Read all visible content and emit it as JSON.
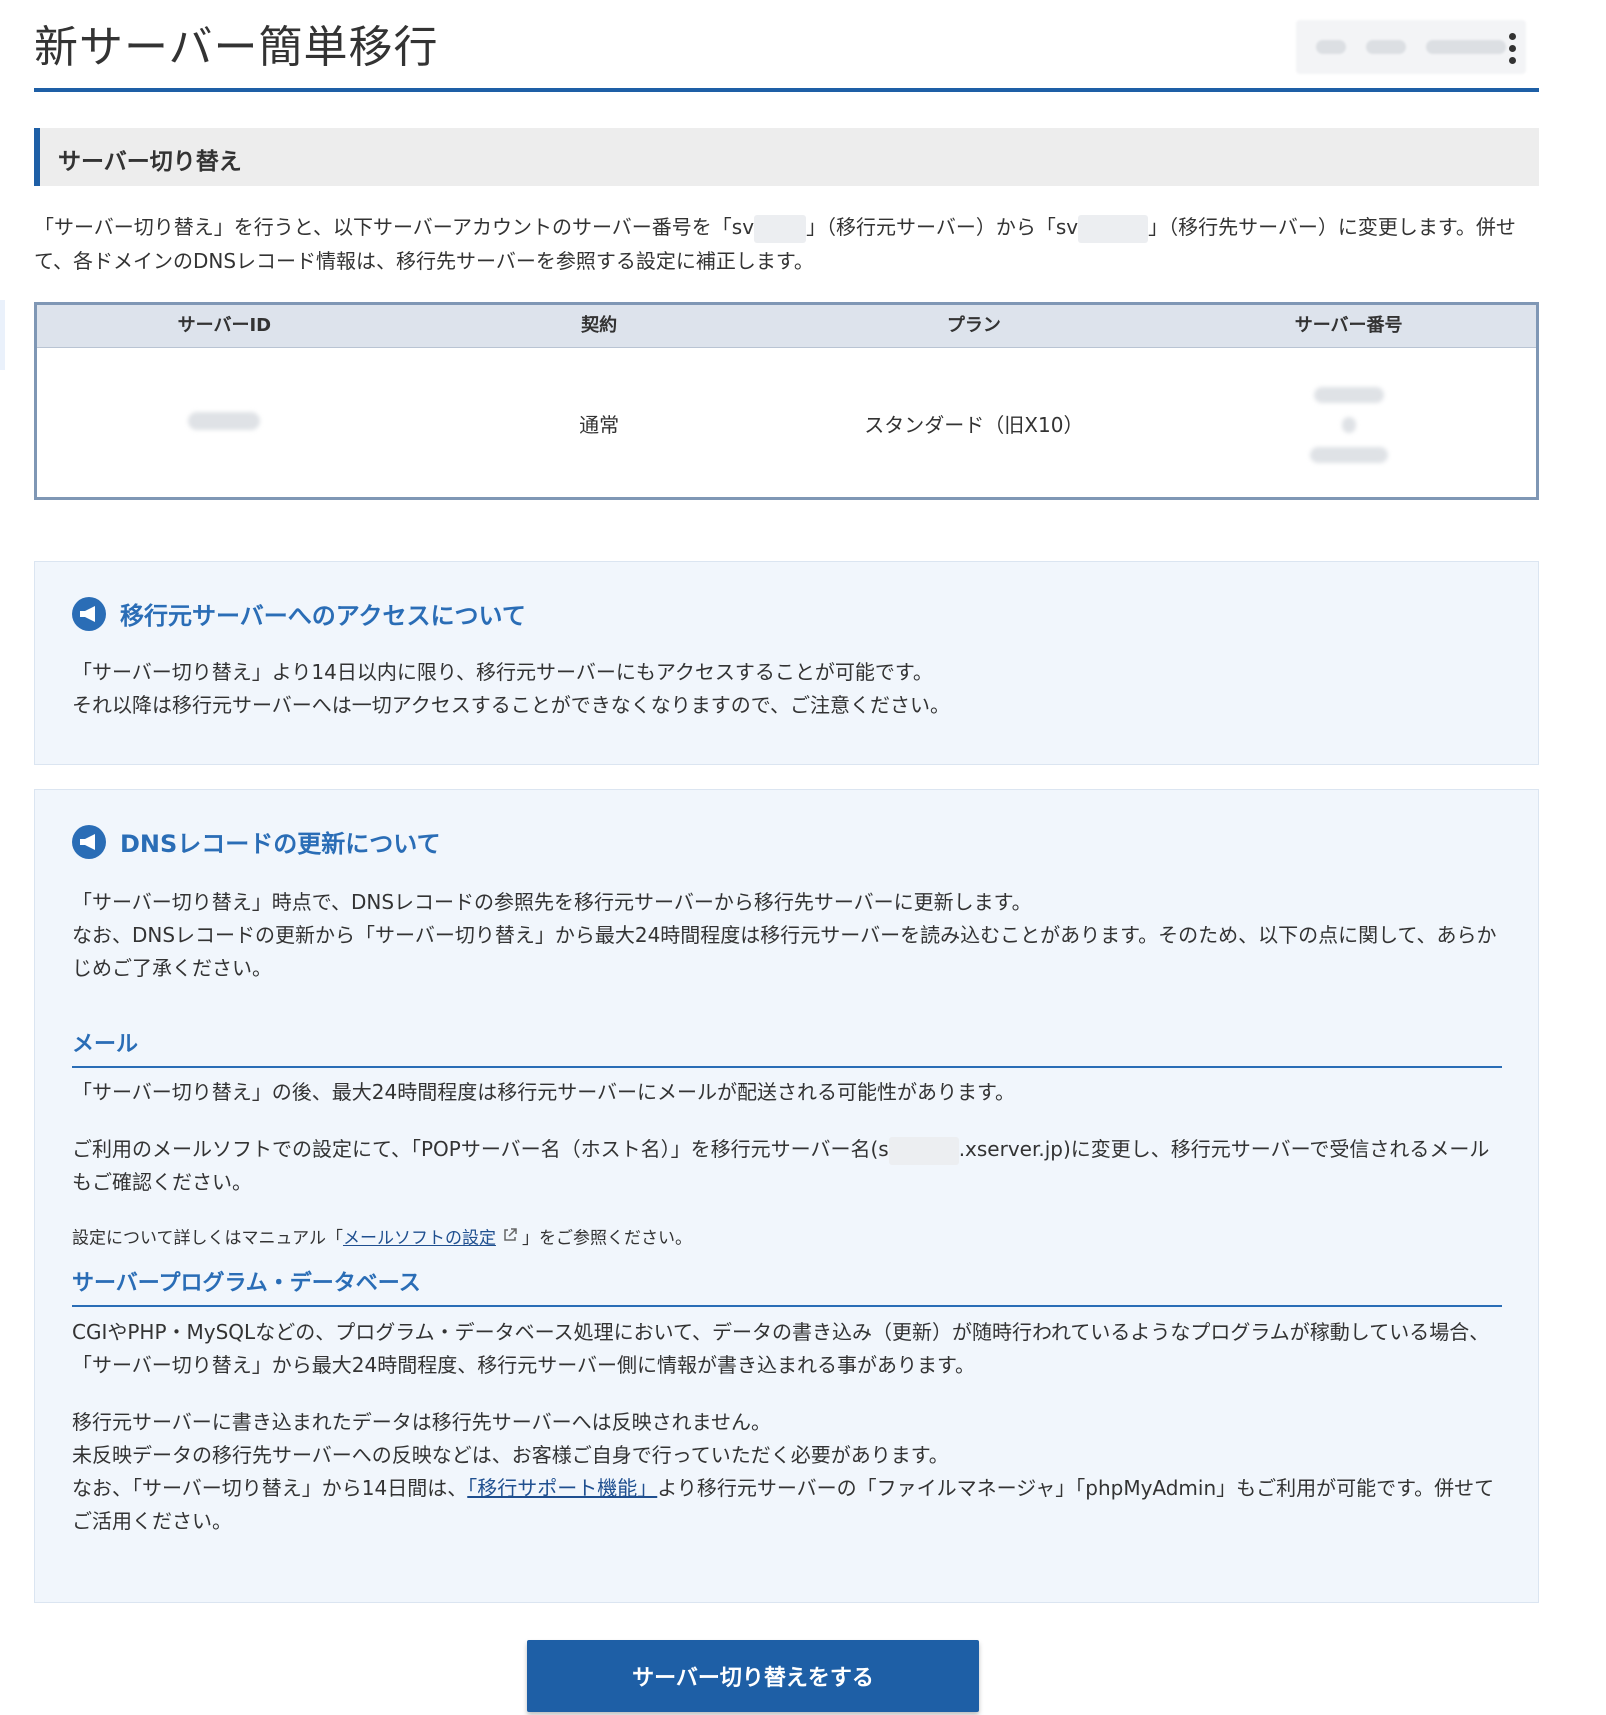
{
  "header": {
    "title": "新サーバー簡単移行"
  },
  "section": {
    "title": "サーバー切り替え"
  },
  "intro": {
    "p1": "「サーバー切り替え」を行うと、以下サーバーアカウントのサーバー番号を「sv",
    "p2": "」（移行元サーバー）から「sv",
    "p3": "」（移行先サーバー）に変更します。併せて、各ドメインのDNSレコード情報は、移行先サーバーを参照する設定に補正します。"
  },
  "table": {
    "headers": [
      "サーバーID",
      "契約",
      "プラン",
      "サーバー番号"
    ],
    "row": {
      "contract": "通常",
      "plan": "スタンダード（旧X10）"
    }
  },
  "notice1": {
    "title": "移行元サーバーへのアクセスについて",
    "line1": "「サーバー切り替え」より14日以内に限り、移行元サーバーにもアクセスすることが可能です。",
    "line2": "それ以降は移行元サーバーへは一切アクセスすることができなくなりますので、ご注意ください。"
  },
  "notice2": {
    "title": "DNSレコードの更新について",
    "intro1": "「サーバー切り替え」時点で、DNSレコードの参照先を移行元サーバーから移行先サーバーに更新します。",
    "intro2": "なお、DNSレコードの更新から「サーバー切り替え」から最大24時間程度は移行元サーバーを読み込むことがあります。そのため、以下の点に関して、あらかじめご了承ください。",
    "mail": {
      "heading": "メール",
      "p1": "「サーバー切り替え」の後、最大24時間程度は移行元サーバーにメールが配送される可能性があります。",
      "p2a": "ご利用のメールソフトでの設定にて、「POPサーバー名（ホスト名）」を移行元サーバー名(s",
      "p2b": ".xserver.jp)に変更し、移行元サーバーで受信されるメールもご確認ください。",
      "p3a": "設定について詳しくはマニュアル「",
      "p3link": "メールソフトの設定",
      "p3b": "」をご参照ください。"
    },
    "program": {
      "heading": "サーバープログラム・データベース",
      "p1": "CGIやPHP・MySQLなどの、プログラム・データベース処理において、データの書き込み（更新）が随時行われているようなプログラムが稼動している場合、「サーバー切り替え」から最大24時間程度、移行元サーバー側に情報が書き込まれる事があります。",
      "p2": "移行元サーバーに書き込まれたデータは移行先サーバーへは反映されません。",
      "p3": "未反映データの移行先サーバーへの反映などは、お客様ご自身で行っていただく必要があります。",
      "p4a": "なお、「サーバー切り替え」から14日間は、",
      "p4link": "「移行サポート機能」",
      "p4b": "より移行元サーバーの「ファイルマネージャ」「phpMyAdmin」もご利用が可能です。併せてご活用ください。"
    }
  },
  "submit": {
    "label": "サーバー切り替えをする"
  },
  "colors": {
    "accent": "#1e5fa6",
    "link": "#2a6db6",
    "notice_bg": "#f1f6fc"
  }
}
